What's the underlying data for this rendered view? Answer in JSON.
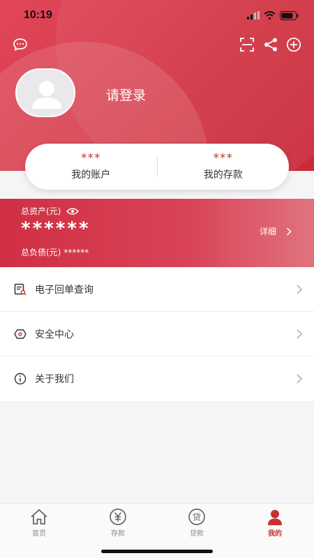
{
  "status_bar": {
    "time": "10:19"
  },
  "profile": {
    "login_prompt": "请登录"
  },
  "summary": {
    "accounts": {
      "value": "***",
      "label": "我的账户"
    },
    "deposits": {
      "value": "***",
      "label": "我的存款"
    }
  },
  "assets": {
    "title": "总资产(元)",
    "masked_value": "******",
    "detail_label": "详细",
    "debt_label": "总负债(元)",
    "debt_masked": "******"
  },
  "menu": {
    "items": [
      {
        "label": "电子回单查询",
        "icon": "receipt-search-icon"
      },
      {
        "label": "安全中心",
        "icon": "shield-icon"
      },
      {
        "label": "关于我们",
        "icon": "info-icon"
      }
    ]
  },
  "tabbar": {
    "items": [
      {
        "label": "首页",
        "icon": "home-icon"
      },
      {
        "label": "存款",
        "icon": "yuan-icon"
      },
      {
        "label": "贷款",
        "icon": "loan-icon"
      },
      {
        "label": "我的",
        "icon": "person-icon"
      }
    ],
    "active_index": 3
  },
  "colors": {
    "brand": "#d23443",
    "active_tab": "#c9302c"
  }
}
